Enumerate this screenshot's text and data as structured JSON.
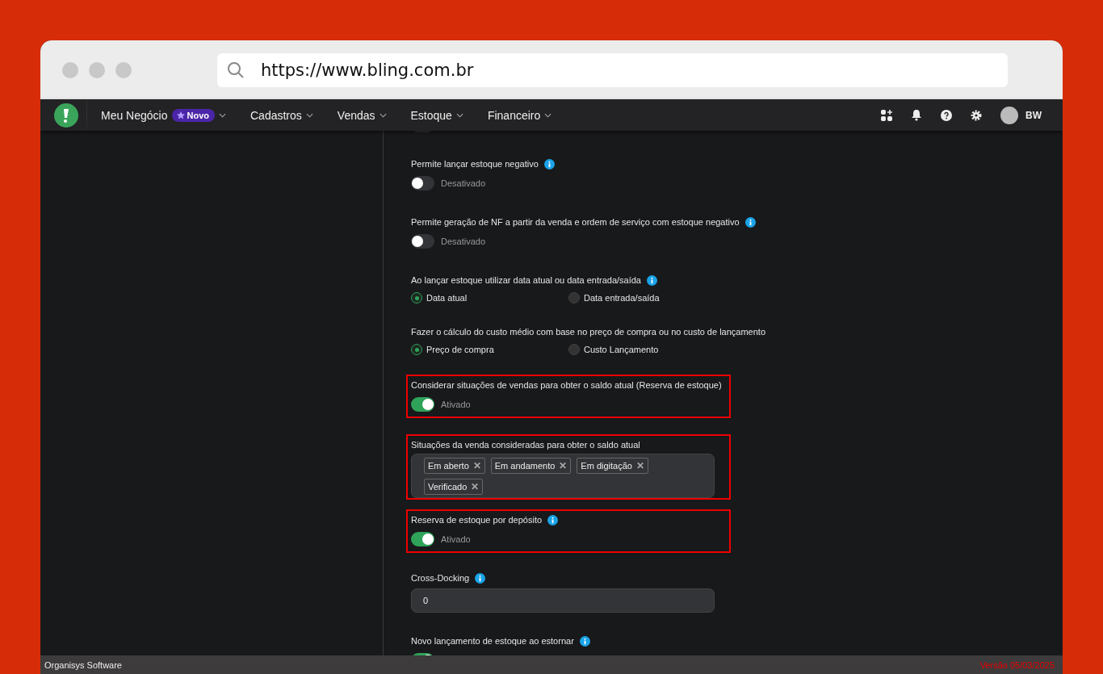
{
  "browser": {
    "url": "https://www.bling.com.br"
  },
  "nav": {
    "items": [
      {
        "label": "Meu Negócio",
        "badge": "Novo"
      },
      {
        "label": "Cadastros"
      },
      {
        "label": "Vendas"
      },
      {
        "label": "Estoque"
      },
      {
        "label": "Financeiro"
      }
    ],
    "user": "BW"
  },
  "settings": [
    {
      "kind": "toggle",
      "on": false,
      "highlighted": false
    },
    {
      "kind": "toggle",
      "label": "Permite lançar estoque negativo",
      "info": true,
      "on": false,
      "state": "Desativado",
      "highlighted": false
    },
    {
      "kind": "toggle",
      "label": "Permite geração de NF a partir da venda e ordem de serviço com estoque negativo",
      "info": true,
      "on": false,
      "state": "Desativado",
      "highlighted": false
    },
    {
      "kind": "radio",
      "label": "Ao lançar estoque utilizar data atual ou data entrada/saída",
      "info": true,
      "options": [
        {
          "label": "Data atual",
          "selected": true
        },
        {
          "label": "Data entrada/saída",
          "selected": false
        }
      ],
      "highlighted": false
    },
    {
      "kind": "radio",
      "label": "Fazer o cálculo do custo médio com base no preço de compra ou no custo de lançamento",
      "info": false,
      "options": [
        {
          "label": "Preço de compra",
          "selected": true
        },
        {
          "label": "Custo Lançamento",
          "selected": false
        }
      ],
      "highlighted": false
    },
    {
      "kind": "toggle",
      "label": "Considerar situações de vendas para obter o saldo atual (Reserva de estoque)",
      "info": false,
      "on": true,
      "state": "Ativado",
      "highlighted": true
    },
    {
      "kind": "tags",
      "label": "Situações da venda consideradas para obter o saldo atual",
      "tags": [
        {
          "label": "Em aberto",
          "remove": "✕"
        },
        {
          "label": "Em andamento",
          "remove": "✕"
        },
        {
          "label": "Em digitação",
          "remove": "✕"
        },
        {
          "label": "Verificado",
          "remove": "✕"
        }
      ],
      "highlighted": true
    },
    {
      "kind": "toggle",
      "label": "Reserva de estoque por depósito",
      "info": true,
      "on": true,
      "state": "Ativado",
      "highlighted": true
    },
    {
      "kind": "input",
      "label": "Cross-Docking",
      "info": true,
      "value": "0",
      "highlighted": false
    },
    {
      "kind": "toggle",
      "label": "Novo lançamento de estoque ao estornar",
      "info": true,
      "on": true,
      "highlighted": false
    }
  ],
  "status_bar": {
    "left": "Organisys Software",
    "right": "Versão 05/03/2025"
  }
}
